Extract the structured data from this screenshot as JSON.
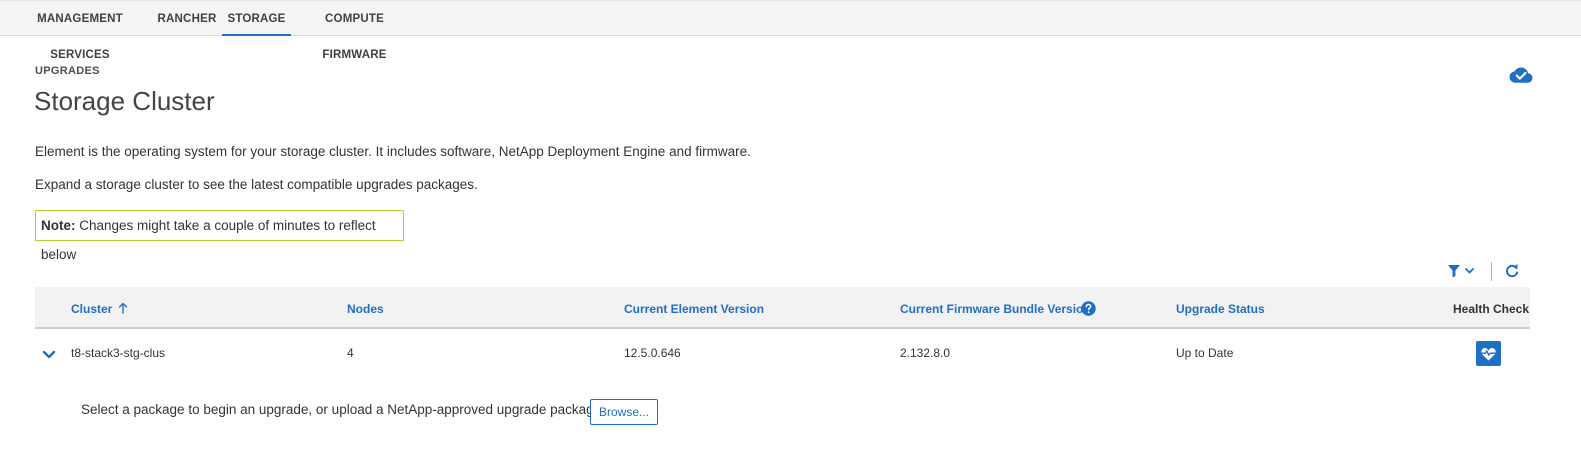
{
  "tabs": [
    {
      "label": "MANAGEMENT SERVICES",
      "active": false
    },
    {
      "label": "RANCHER",
      "active": false
    },
    {
      "label": "STORAGE",
      "active": true
    },
    {
      "label": "COMPUTE FIRMWARE",
      "active": false
    }
  ],
  "header": {
    "breadcrumb": "UPGRADES",
    "title": "Storage Cluster",
    "status_icon": "cloud-check-icon"
  },
  "descriptions": [
    "Element is the operating system for your storage cluster. It includes software, NetApp Deployment Engine and firmware.",
    "Expand a storage cluster to see the latest compatible upgrades packages."
  ],
  "note": {
    "label": "Note:",
    "text": " Changes might take a couple of minutes to reflect below"
  },
  "toolbar": {
    "filter_icon": "filter-icon",
    "refresh_icon": "refresh-icon"
  },
  "table": {
    "columns": [
      "Cluster",
      "Nodes",
      "Current Element Version",
      "Current Firmware Bundle Version",
      "Upgrade Status",
      "Health Check"
    ],
    "sort_column": "Cluster",
    "sort_direction": "ascending",
    "rows": [
      {
        "cluster": "t8-stack3-stg-clus",
        "nodes": "4",
        "element_version": "12.5.0.646",
        "firmware_version": "2.132.8.0",
        "upgrade_status": "Up to Date",
        "health_icon": "heart-pulse-icon",
        "expanded": true
      }
    ]
  },
  "expanded_panel": {
    "text": "Select a package to begin an upgrade, or upload a NetApp-approved upgrade package.",
    "browse_label": "Browse..."
  },
  "colors": {
    "accent": "#1f6fc5",
    "note_border": "#b5d12f",
    "tab_active_underline": "#2a6fcb"
  }
}
